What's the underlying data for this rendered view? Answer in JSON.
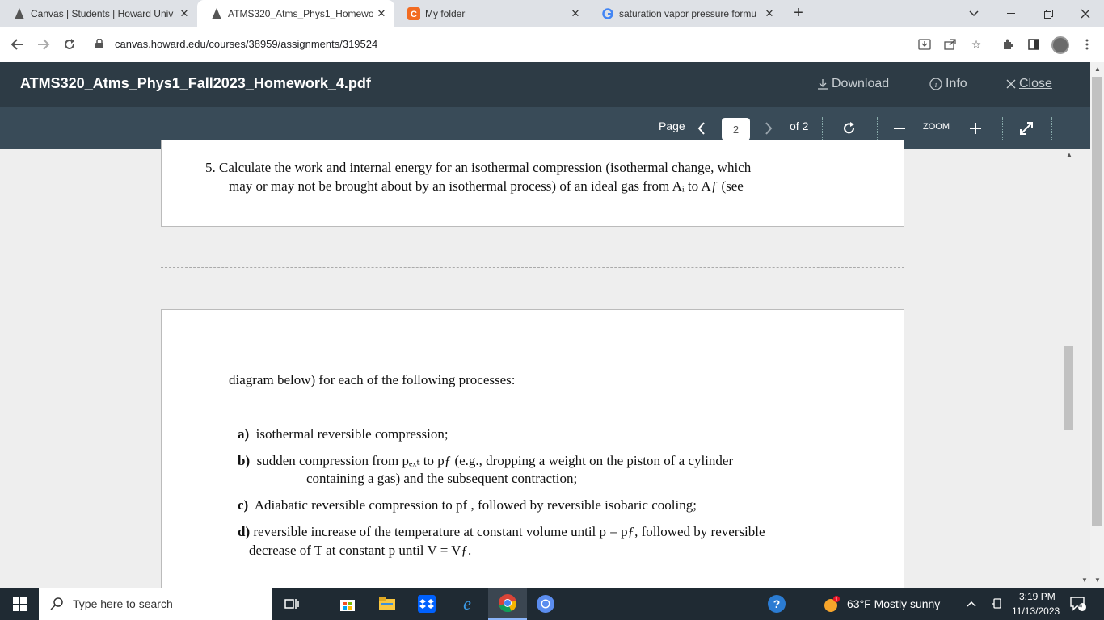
{
  "browser": {
    "tabs": [
      {
        "title": "Canvas | Students | Howard Univ",
        "icon": "canvas-icon"
      },
      {
        "title": "ATMS320_Atms_Phys1_Homewo",
        "icon": "canvas-icon"
      },
      {
        "title": "My folder",
        "icon": "c-orange-icon"
      },
      {
        "title": "saturation vapor pressure formu",
        "icon": "google-icon"
      }
    ],
    "active_tab": 1,
    "url": "canvas.howard.edu/courses/38959/assignments/319524"
  },
  "viewer": {
    "title": "ATMS320_Atms_Phys1_Fall2023_Homework_4.pdf",
    "download_label": "Download",
    "info_label": "Info",
    "close_label": "Close",
    "page_label": "Page",
    "page_value": "2",
    "page_of": "of 2",
    "zoom_label": "ZOOM"
  },
  "document": {
    "page1": {
      "line1": "5. Calculate the work and internal energy for an isothermal compression (isothermal change, which",
      "line2": "may or may not be brought about by an isothermal process) of an ideal gas from Aᵢ to Aƒ (see"
    },
    "page2": {
      "intro": "diagram below) for each of the following processes:",
      "items": [
        {
          "label": "a)",
          "text": "isothermal reversible compression;"
        },
        {
          "label": "b)",
          "text": "sudden compression from pₑₓₜ to pƒ (e.g., dropping a weight on the piston of a cylinder",
          "cont": "containing a gas) and the subsequent contraction;"
        },
        {
          "label": "c)",
          "text": "Adiabatic reversible compression to pf , followed by reversible isobaric cooling;"
        },
        {
          "label": "d)",
          "text": "reversible increase of the temperature at constant volume until p = pƒ, followed by reversible",
          "cont": "decrease of T at constant p until V = Vƒ."
        }
      ]
    }
  },
  "taskbar": {
    "search_placeholder": "Type here to search",
    "weather": "63°F  Mostly sunny",
    "time": "3:19 PM",
    "date": "11/13/2023",
    "notifications": "4"
  }
}
